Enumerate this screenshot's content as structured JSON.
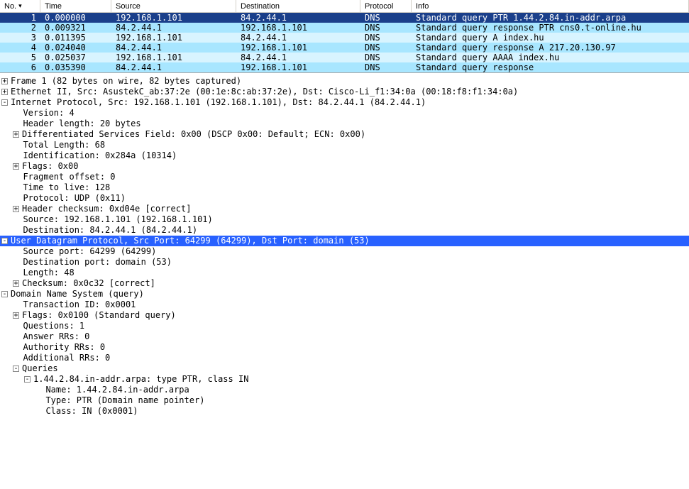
{
  "columns": [
    {
      "label": "No.",
      "class": "col-no",
      "sort": true
    },
    {
      "label": "Time",
      "class": "col-time"
    },
    {
      "label": "Source",
      "class": "col-source"
    },
    {
      "label": "Destination",
      "class": "col-dest"
    },
    {
      "label": "Protocol",
      "class": "col-protocol"
    },
    {
      "label": "Info",
      "class": "col-info"
    }
  ],
  "packets": [
    {
      "no": "1",
      "time": "0.000000",
      "source": "192.168.1.101",
      "dest": "84.2.44.1",
      "protocol": "DNS",
      "info": "Standard query PTR 1.44.2.84.in-addr.arpa",
      "style": "row-selected"
    },
    {
      "no": "2",
      "time": "0.009321",
      "source": "84.2.44.1",
      "dest": "192.168.1.101",
      "protocol": "DNS",
      "info": "Standard query response PTR cns0.t-online.hu",
      "style": "row-alt-even"
    },
    {
      "no": "3",
      "time": "0.011395",
      "source": "192.168.1.101",
      "dest": "84.2.44.1",
      "protocol": "DNS",
      "info": "Standard query A index.hu",
      "style": "row-alt-odd"
    },
    {
      "no": "4",
      "time": "0.024040",
      "source": "84.2.44.1",
      "dest": "192.168.1.101",
      "protocol": "DNS",
      "info": "Standard query response A 217.20.130.97",
      "style": "row-alt-even"
    },
    {
      "no": "5",
      "time": "0.025037",
      "source": "192.168.1.101",
      "dest": "84.2.44.1",
      "protocol": "DNS",
      "info": "Standard query AAAA index.hu",
      "style": "row-alt-odd"
    },
    {
      "no": "6",
      "time": "0.035390",
      "source": "84.2.44.1",
      "dest": "192.168.1.101",
      "protocol": "DNS",
      "info": "Standard query response",
      "style": "row-alt-even"
    }
  ],
  "details": [
    {
      "indent": 0,
      "expander": "+",
      "text": "Frame 1 (82 bytes on wire, 82 bytes captured)"
    },
    {
      "indent": 0,
      "expander": "+",
      "text": "Ethernet II, Src: AsustekC_ab:37:2e (00:1e:8c:ab:37:2e), Dst: Cisco-Li_f1:34:0a (00:18:f8:f1:34:0a)"
    },
    {
      "indent": 0,
      "expander": "-",
      "text": "Internet Protocol, Src: 192.168.1.101 (192.168.1.101), Dst: 84.2.44.1 (84.2.44.1)"
    },
    {
      "indent": 1,
      "text": "  Version: 4"
    },
    {
      "indent": 1,
      "text": "  Header length: 20 bytes"
    },
    {
      "indent": 1,
      "expander": "+",
      "text": "Differentiated Services Field: 0x00 (DSCP 0x00: Default; ECN: 0x00)"
    },
    {
      "indent": 1,
      "text": "  Total Length: 68"
    },
    {
      "indent": 1,
      "text": "  Identification: 0x284a (10314)"
    },
    {
      "indent": 1,
      "expander": "+",
      "text": "Flags: 0x00"
    },
    {
      "indent": 1,
      "text": "  Fragment offset: 0"
    },
    {
      "indent": 1,
      "text": "  Time to live: 128"
    },
    {
      "indent": 1,
      "text": "  Protocol: UDP (0x11)"
    },
    {
      "indent": 1,
      "expander": "+",
      "text": "Header checksum: 0xd04e [correct]"
    },
    {
      "indent": 1,
      "text": "  Source: 192.168.1.101 (192.168.1.101)"
    },
    {
      "indent": 1,
      "text": "  Destination: 84.2.44.1 (84.2.44.1)"
    },
    {
      "indent": 0,
      "expander": "-",
      "text": "User Datagram Protocol, Src Port: 64299 (64299), Dst Port: domain (53)",
      "selected": true
    },
    {
      "indent": 1,
      "text": "  Source port: 64299 (64299)"
    },
    {
      "indent": 1,
      "text": "  Destination port: domain (53)"
    },
    {
      "indent": 1,
      "text": "  Length: 48"
    },
    {
      "indent": 1,
      "expander": "+",
      "text": "Checksum: 0x0c32 [correct]"
    },
    {
      "indent": 0,
      "expander": "-",
      "text": "Domain Name System (query)"
    },
    {
      "indent": 1,
      "text": "  Transaction ID: 0x0001"
    },
    {
      "indent": 1,
      "expander": "+",
      "text": "Flags: 0x0100 (Standard query)"
    },
    {
      "indent": 1,
      "text": "  Questions: 1"
    },
    {
      "indent": 1,
      "text": "  Answer RRs: 0"
    },
    {
      "indent": 1,
      "text": "  Authority RRs: 0"
    },
    {
      "indent": 1,
      "text": "  Additional RRs: 0"
    },
    {
      "indent": 1,
      "expander": "-",
      "text": "Queries"
    },
    {
      "indent": 2,
      "expander": "-",
      "text": "1.44.2.84.in-addr.arpa: type PTR, class IN"
    },
    {
      "indent": 3,
      "text": "  Name: 1.44.2.84.in-addr.arpa"
    },
    {
      "indent": 3,
      "text": "  Type: PTR (Domain name pointer)"
    },
    {
      "indent": 3,
      "text": "  Class: IN (0x0001)"
    }
  ]
}
